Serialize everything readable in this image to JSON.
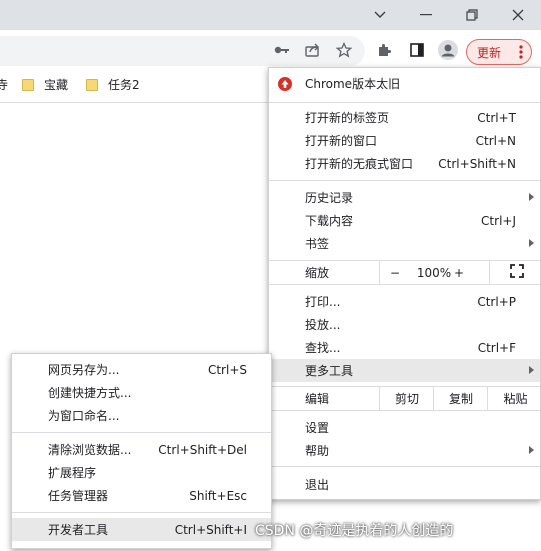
{
  "bookmarks": [
    {
      "label": "宝藏",
      "icon": "folder-icon"
    },
    {
      "label": "任务2",
      "icon": "folder-icon"
    }
  ],
  "update_button": {
    "label": "更新"
  },
  "menu": {
    "chrome_outdated": "Chrome版本太旧",
    "new_tab": {
      "label": "打开新的标签页",
      "shortcut": "Ctrl+T"
    },
    "new_window": {
      "label": "打开新的窗口",
      "shortcut": "Ctrl+N"
    },
    "incognito": {
      "label": "打开新的无痕式窗口",
      "shortcut": "Ctrl+Shift+N"
    },
    "history": {
      "label": "历史记录"
    },
    "downloads": {
      "label": "下载内容",
      "shortcut": "Ctrl+J"
    },
    "bookmarks": {
      "label": "书签"
    },
    "zoom": {
      "label": "缩放",
      "minus": "−",
      "value": "100%",
      "plus": "+"
    },
    "print": {
      "label": "打印...",
      "shortcut": "Ctrl+P"
    },
    "cast": {
      "label": "投放..."
    },
    "find": {
      "label": "查找...",
      "shortcut": "Ctrl+F"
    },
    "more_tools": {
      "label": "更多工具"
    },
    "edit": {
      "label": "编辑",
      "cut": "剪切",
      "copy": "复制",
      "paste": "粘贴"
    },
    "settings": {
      "label": "设置"
    },
    "help": {
      "label": "帮助"
    },
    "exit": {
      "label": "退出"
    }
  },
  "submenu": {
    "save_page": {
      "label": "网页另存为...",
      "shortcut": "Ctrl+S"
    },
    "create_shortcut": {
      "label": "创建快捷方式..."
    },
    "name_window": {
      "label": "为窗口命名..."
    },
    "clear_data": {
      "label": "清除浏览数据...",
      "shortcut": "Ctrl+Shift+Del"
    },
    "extensions": {
      "label": "扩展程序"
    },
    "task_manager": {
      "label": "任务管理器",
      "shortcut": "Shift+Esc"
    },
    "devtools": {
      "label": "开发者工具",
      "shortcut": "Ctrl+Shift+I"
    }
  },
  "watermark": "CSDN @奇迹是执着的人创造的",
  "colors": {
    "accent_red": "#c5221f",
    "update_bg": "#fce8e6"
  }
}
